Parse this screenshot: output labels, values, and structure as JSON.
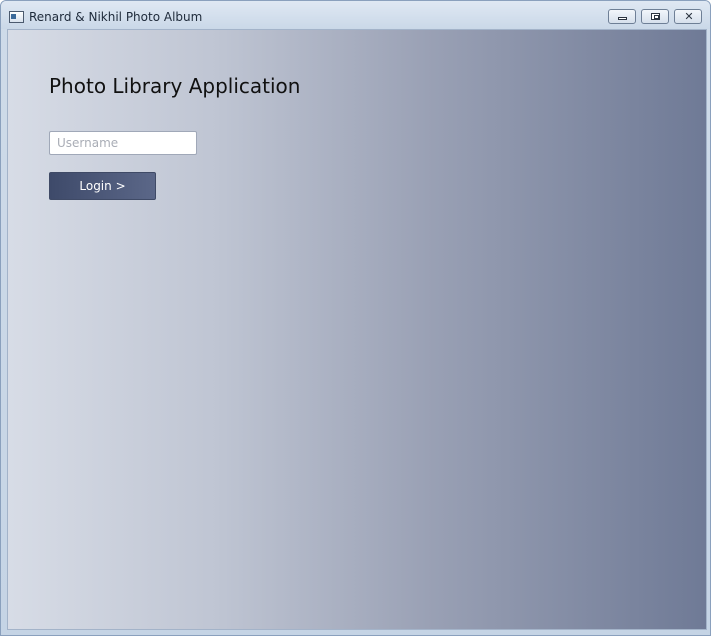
{
  "window": {
    "title": "Renard & Nikhil Photo Album",
    "controls": {
      "minimize_icon": "minimize-icon",
      "maximize_icon": "restore-icon",
      "close_glyph": "✕"
    }
  },
  "main": {
    "heading": "Photo Library Application",
    "username": {
      "placeholder": "Username",
      "value": ""
    },
    "login_button_label": "Login >"
  },
  "colors": {
    "gradient_left": "#d7dce6",
    "gradient_right": "#6f7a96",
    "button_bg": "#3e4a6a",
    "button_text": "#ffffff"
  }
}
